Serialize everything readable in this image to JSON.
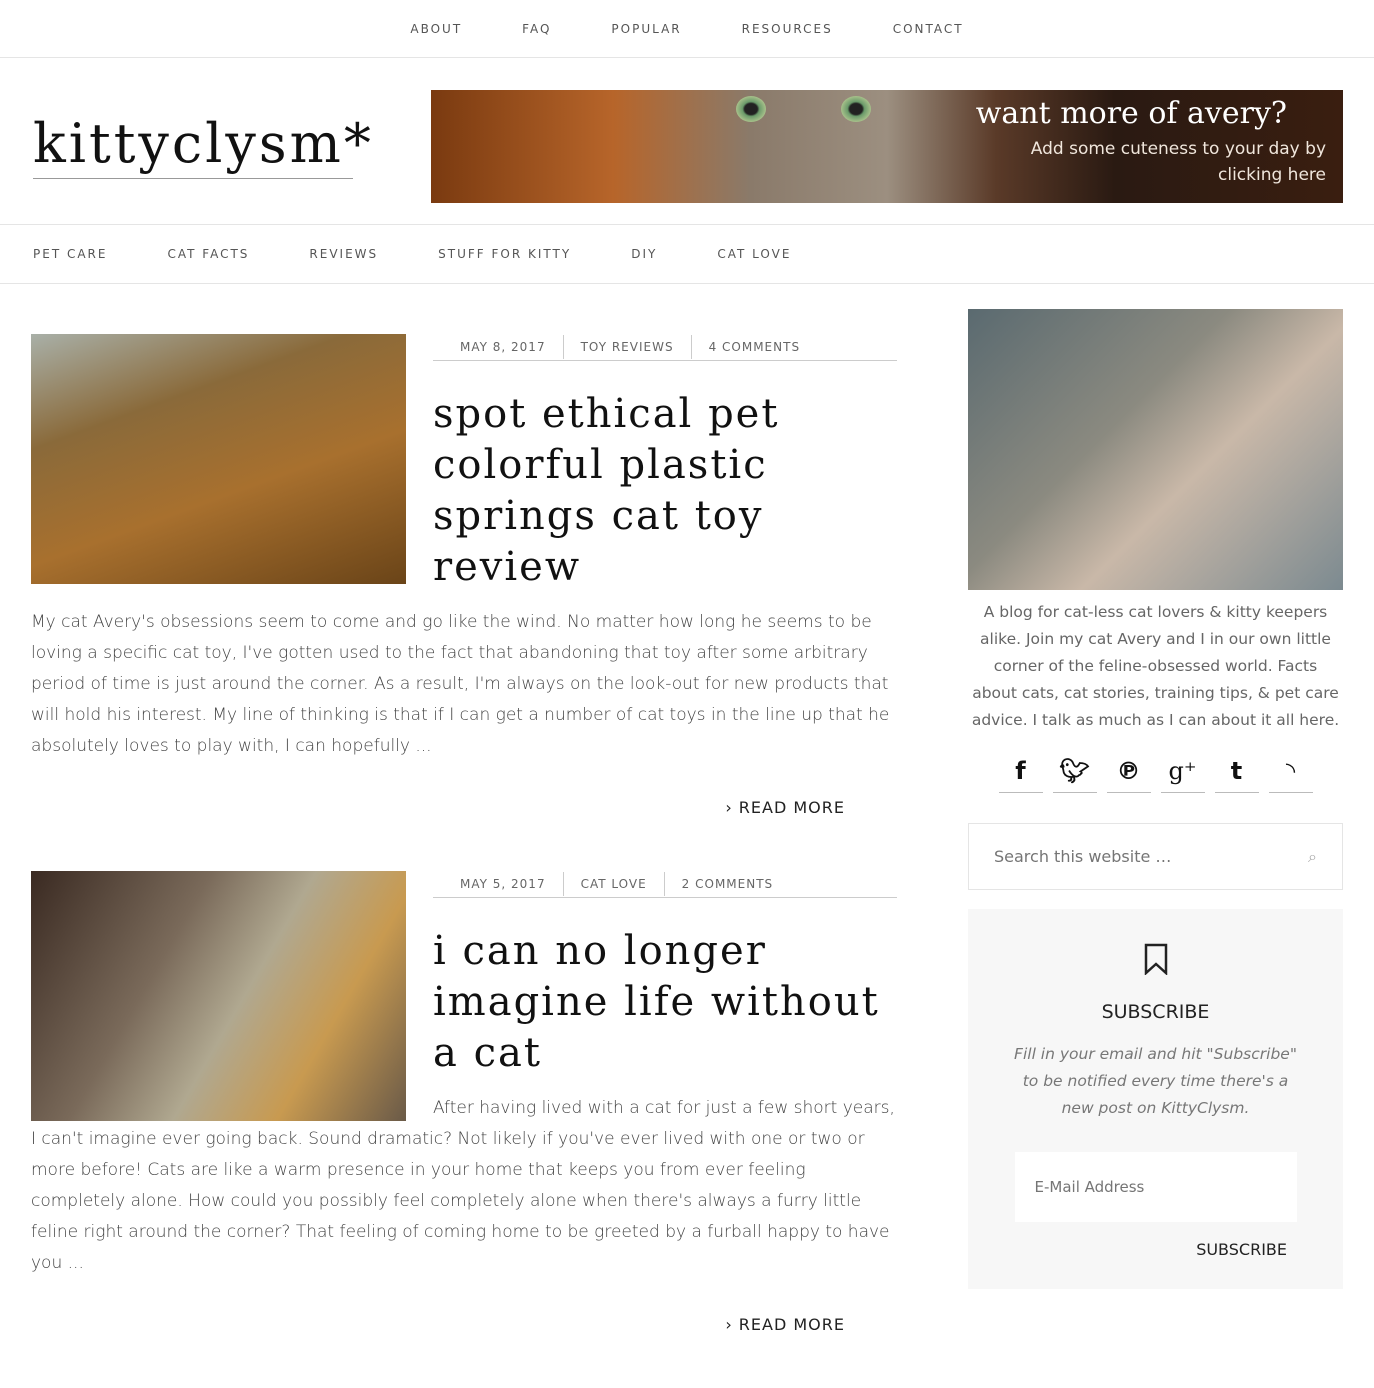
{
  "top_nav": [
    "ABOUT",
    "FAQ",
    "POPULAR",
    "RESOURCES",
    "CONTACT"
  ],
  "logo": "kittyclysm*",
  "banner": {
    "title": "want more of avery?",
    "subtitle": "Add some cuteness to your day by clicking here"
  },
  "category_nav": [
    "PET CARE",
    "CAT FACTS",
    "REVIEWS",
    "STUFF FOR KITTY",
    "DIY",
    "CAT LOVE"
  ],
  "posts": [
    {
      "date": "MAY 8, 2017",
      "category": "TOY REVIEWS",
      "comments": "4 COMMENTS",
      "title": "spot ethical pet colorful plastic springs cat toy review",
      "excerpt": "My cat Avery's obsessions seem to come and go like the wind. No matter how long he seems to be loving a specific cat toy, I've gotten used to the fact that abandoning that toy after some arbitrary period of time is just around the corner. As a result, I'm always on the look-out for new products that will hold his interest. My line of thinking is that if I can get a number of cat toys in the line up that he absolutely loves to play with, I can hopefully ...",
      "read_more": "READ MORE"
    },
    {
      "date": "MAY 5, 2017",
      "category": "CAT LOVE",
      "comments": "2 COMMENTS",
      "title": "i can no longer imagine life without a cat",
      "excerpt": "After having lived with a cat for just a few short years, I can't imagine ever going back. Sound dramatic? Not likely if you've ever lived with one or two or more before! Cats are like a warm presence in your home that keeps you from ever feeling completely alone. How could you possibly feel completely alone when there's always a furry little feline right around the corner? That feeling of coming home to be greeted by a furball happy to have you ...",
      "read_more": "READ MORE"
    }
  ],
  "sidebar": {
    "about": "A blog for cat-less cat lovers & kitty keepers alike. Join my cat Avery and I in our own little corner of the feline-obsessed world. Facts about cats, cat stories, training tips, & pet care advice. I talk as much as I can about it all here.",
    "social": [
      "facebook-icon",
      "twitter-icon",
      "pinterest-icon",
      "google-plus-icon",
      "tumblr-icon",
      "rss-icon"
    ],
    "search_placeholder": "Search this website …",
    "subscribe": {
      "title": "SUBSCRIBE",
      "text": "Fill in your email and hit \"Subscribe\" to be notified every time there's a new post on KittyClysm.",
      "email_placeholder": "E-Mail Address",
      "button": "SUBSCRIBE"
    }
  }
}
